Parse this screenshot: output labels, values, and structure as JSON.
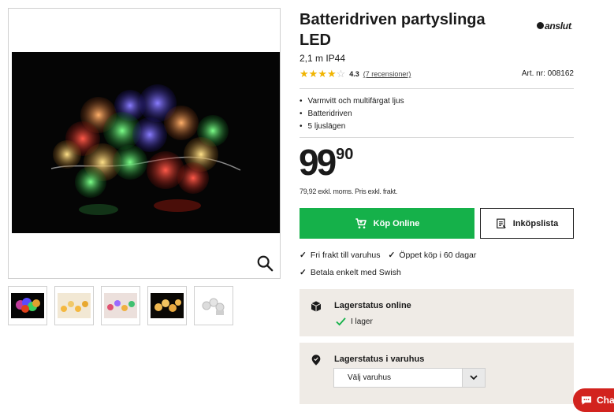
{
  "product": {
    "title": "Batteridriven partyslinga LED",
    "subtitle": "2,1 m IP44",
    "brand": "anslut",
    "rating_value": "4.3",
    "rating": 4.3,
    "reviews": "(7 recensioner)",
    "article_number": "Art. nr: 008162",
    "features": [
      "Varmvitt och multifärgat ljus",
      "Batteridriven",
      "5 ljuslägen"
    ]
  },
  "price": {
    "main": "99",
    "decimals": "90",
    "note": "79,92 exkl. moms. Pris exkl. frakt."
  },
  "actions": {
    "buy_label": "Köp Online",
    "list_label": "Inköpslista"
  },
  "usps": [
    "Fri frakt till varuhus",
    "Öppet köp i 60 dagar",
    "Betala enkelt med Swish"
  ],
  "stock": {
    "online_title": "Lagerstatus online",
    "online_status": "I lager",
    "store_title": "Lagerstatus i varuhus",
    "store_select": "Välj varuhus"
  },
  "chat": {
    "label": "Cha"
  },
  "colors": {
    "accent": "#15b14a",
    "stock_bg": "#efebe6",
    "chat": "#d2231e",
    "star": "#f0b400"
  },
  "icons": [
    "search-icon",
    "cart-icon",
    "list-icon",
    "box-icon",
    "location-pin-icon",
    "check-icon",
    "chevron-down-icon",
    "chat-icon"
  ]
}
